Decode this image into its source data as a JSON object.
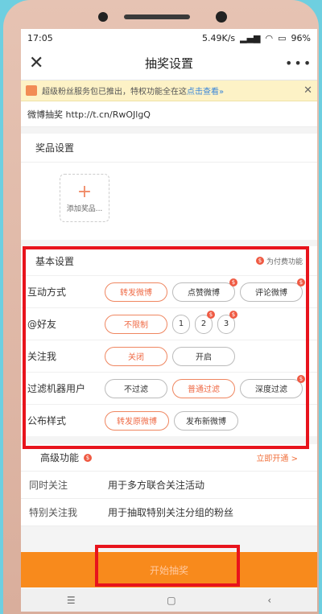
{
  "status": {
    "time": "17:05",
    "net": "5.49K/s",
    "battery": "96%"
  },
  "header": {
    "title": "抽奖设置",
    "close_icon": "close-icon",
    "more_icon": "more-icon"
  },
  "notice": {
    "text": "超级粉丝服务包已推出，特权功能全在这",
    "link": "点击查看»"
  },
  "weibo": {
    "text": "微博抽奖 http://t.cn/RwOJlgQ"
  },
  "prize": {
    "title": "奖品设置",
    "add_label": "添加奖品..."
  },
  "basic": {
    "title": "基本设置",
    "paid_label": "为付费功能",
    "rows": [
      {
        "label": "互动方式",
        "options": [
          "转发微博",
          "点赞微博",
          "评论微博"
        ]
      },
      {
        "label": "@好友",
        "options": [
          "不限制",
          "1",
          "2",
          "3"
        ]
      },
      {
        "label": "关注我",
        "options": [
          "关闭",
          "开启"
        ]
      },
      {
        "label": "过滤机器用户",
        "options": [
          "不过滤",
          "普通过滤",
          "深度过滤"
        ]
      },
      {
        "label": "公布样式",
        "options": [
          "转发原微博",
          "发布新微博"
        ]
      }
    ]
  },
  "advanced": {
    "title": "高级功能",
    "open_link": "立即开通 >",
    "rows": [
      {
        "label": "同时关注",
        "desc": "用于多方联合关注活动"
      },
      {
        "label": "特别关注我",
        "desc": "用于抽取特别关注分组的粉丝"
      }
    ]
  },
  "start_button": "开始抽奖",
  "colors": {
    "accent": "#ef6a45",
    "button": "#f88a1c",
    "highlight": "#e8131c"
  }
}
